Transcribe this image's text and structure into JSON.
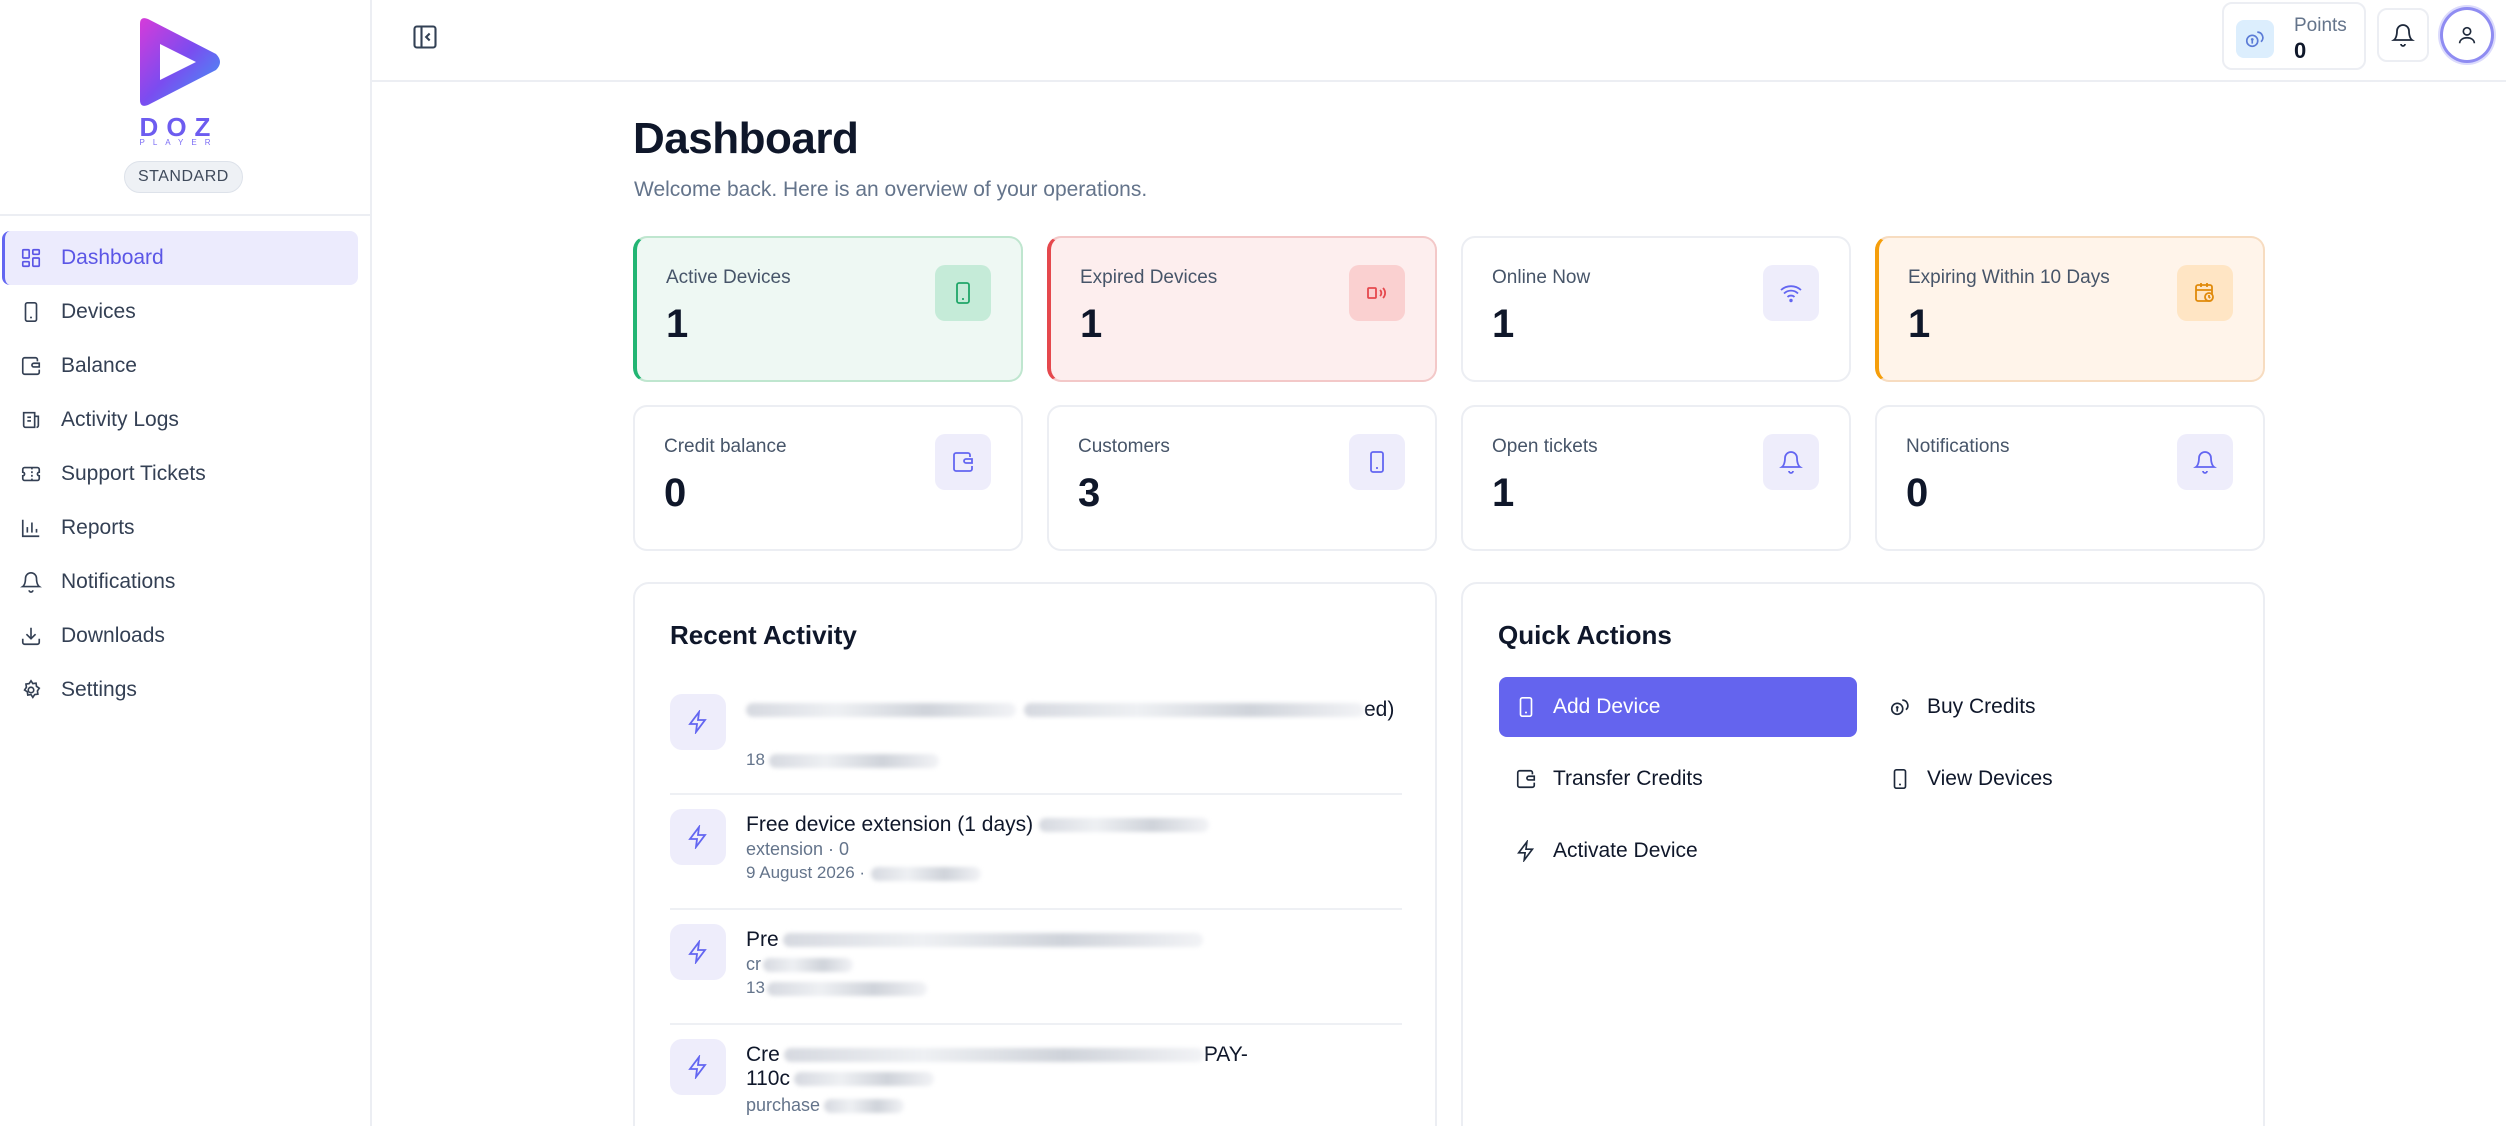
{
  "brand": {
    "logo_text": "DOZ",
    "logo_sub": "PLAYER",
    "plan": "STANDARD"
  },
  "sidebar": {
    "items": [
      {
        "label": "Dashboard",
        "icon": "dashboard-icon",
        "active": true
      },
      {
        "label": "Devices",
        "icon": "device-icon"
      },
      {
        "label": "Balance",
        "icon": "wallet-icon"
      },
      {
        "label": "Activity Logs",
        "icon": "logs-icon"
      },
      {
        "label": "Support Tickets",
        "icon": "ticket-icon"
      },
      {
        "label": "Reports",
        "icon": "chart-icon"
      },
      {
        "label": "Notifications",
        "icon": "bell-icon"
      },
      {
        "label": "Downloads",
        "icon": "download-icon"
      },
      {
        "label": "Settings",
        "icon": "gear-icon"
      }
    ]
  },
  "topbar": {
    "points_label": "Points",
    "points_value": "0"
  },
  "page": {
    "title": "Dashboard",
    "subtitle": "Welcome back. Here is an overview of your operations."
  },
  "stats": [
    {
      "label": "Active Devices",
      "value": "1",
      "icon": "phone-icon",
      "tone": "green"
    },
    {
      "label": "Expired Devices",
      "value": "1",
      "icon": "signal-off-icon",
      "tone": "red"
    },
    {
      "label": "Online Now",
      "value": "1",
      "icon": "wifi-icon",
      "tone": "neutral"
    },
    {
      "label": "Expiring Within 10 Days",
      "value": "1",
      "icon": "calendar-clock-icon",
      "tone": "orange"
    },
    {
      "label": "Credit balance",
      "value": "0",
      "icon": "wallet-icon",
      "tone": "neutral"
    },
    {
      "label": "Customers",
      "value": "3",
      "icon": "tablet-icon",
      "tone": "neutral"
    },
    {
      "label": "Open tickets",
      "value": "1",
      "icon": "bell-icon",
      "tone": "neutral"
    },
    {
      "label": "Notifications",
      "value": "0",
      "icon": "bell-icon",
      "tone": "neutral"
    }
  ],
  "recent_activity": {
    "title": "Recent Activity",
    "items": [
      {
        "title": "ed)",
        "sub": "",
        "date": "18"
      },
      {
        "title": "Free device extension (1 days)",
        "sub": "extension · 0",
        "date": "9 August 2026 ·"
      },
      {
        "title": "Pre",
        "sub": "cr",
        "date": "13"
      },
      {
        "title": "Cre",
        "title2": "110c",
        "title_tail": "PAY-",
        "sub": "purchase",
        "date": ""
      }
    ]
  },
  "quick_actions": {
    "title": "Quick Actions",
    "buttons": [
      {
        "label": "Add Device",
        "icon": "tablet-icon",
        "primary": true
      },
      {
        "label": "Buy Credits",
        "icon": "coins-icon"
      },
      {
        "label": "Transfer Credits",
        "icon": "wallet-icon"
      },
      {
        "label": "View Devices",
        "icon": "tablet-icon"
      },
      {
        "label": "Activate Device",
        "icon": "bolt-icon"
      }
    ]
  },
  "colors": {
    "accent": "#6464ee",
    "active_nav_bg": "#ecebfd",
    "green": "#22b573",
    "red": "#e5484d",
    "orange": "#f59e0b"
  }
}
